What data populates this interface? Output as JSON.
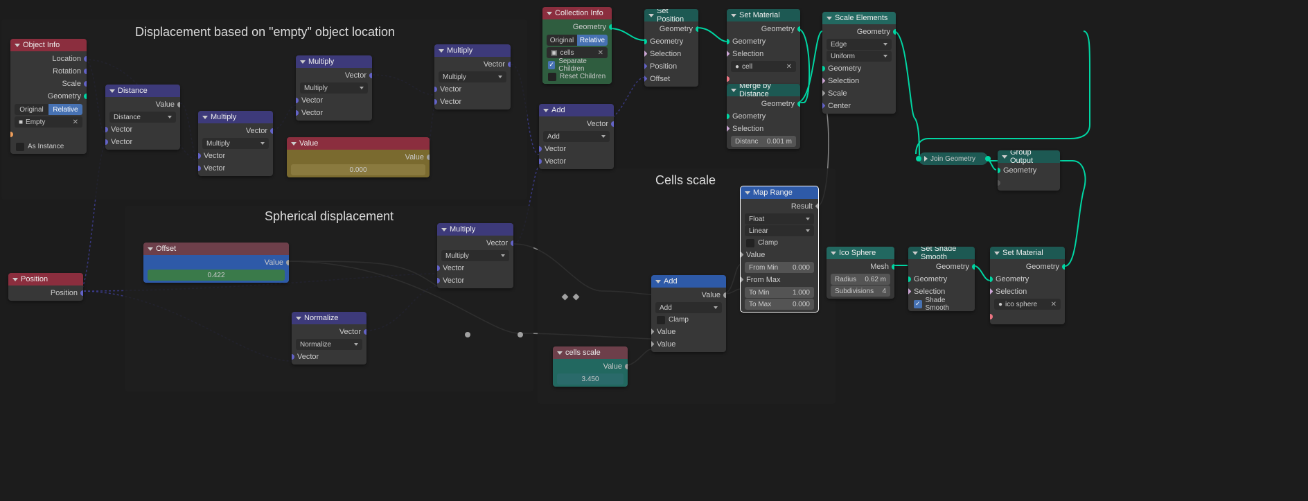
{
  "frames": {
    "f1": {
      "label": "Displacement based on \"empty\" object location"
    },
    "f2": {
      "label": "Spherical displacement"
    },
    "f3": {
      "label": "Cells scale"
    }
  },
  "nodes": {
    "object_info": {
      "title": "Object Info",
      "out": [
        "Location",
        "Rotation",
        "Scale",
        "Geometry"
      ],
      "toggle": [
        "Original",
        "Relative"
      ],
      "toggle_active": 1,
      "object": "Empty",
      "as_instance": "As Instance"
    },
    "distance": {
      "title": "Distance",
      "out": [
        "Value"
      ],
      "mode": "Distance",
      "in": [
        "Vector",
        "Vector"
      ]
    },
    "mult1": {
      "title": "Multiply",
      "out": [
        "Vector"
      ],
      "mode": "Multiply",
      "in": [
        "Vector",
        "Vector"
      ]
    },
    "mult2": {
      "title": "Multiply",
      "out": [
        "Vector"
      ],
      "mode": "Multiply",
      "in": [
        "Vector",
        "Vector"
      ]
    },
    "mult3": {
      "title": "Multiply",
      "out": [
        "Vector"
      ],
      "mode": "Multiply",
      "in": [
        "Vector",
        "Vector"
      ]
    },
    "value1": {
      "title": "Value",
      "value": "0.000"
    },
    "position": {
      "title": "Position",
      "out": [
        "Position"
      ]
    },
    "offset": {
      "title": "Offset",
      "out": [
        "Value"
      ],
      "value": "0.422"
    },
    "normalize": {
      "title": "Normalize",
      "out": [
        "Vector"
      ],
      "mode": "Normalize",
      "in": [
        "Vector"
      ]
    },
    "mult4": {
      "title": "Multiply",
      "out": [
        "Vector"
      ],
      "mode": "Multiply",
      "in": [
        "Vector",
        "Vector"
      ]
    },
    "add1": {
      "title": "Add",
      "out": [
        "Vector"
      ],
      "mode": "Add",
      "in": [
        "Vector",
        "Vector"
      ]
    },
    "collection_info": {
      "title": "Collection Info",
      "out": [
        "Geometry"
      ],
      "toggle": [
        "Original",
        "Relative"
      ],
      "toggle_active": 1,
      "collection": "cells",
      "separate": "Separate Children",
      "reset": "Reset Children"
    },
    "cells_scale": {
      "title": "cells scale",
      "out": [
        "Value"
      ],
      "value": "3.450"
    },
    "add2": {
      "title": "Add",
      "out": [
        "Value"
      ],
      "mode": "Add",
      "clamp": "Clamp",
      "in": [
        "Value",
        "Value"
      ]
    },
    "set_position": {
      "title": "Set Position",
      "out": [
        "Geometry"
      ],
      "in": [
        "Geometry",
        "Selection",
        "Position",
        "Offset"
      ]
    },
    "set_material1": {
      "title": "Set Material",
      "out": [
        "Geometry"
      ],
      "in": [
        "Geometry",
        "Selection"
      ],
      "mat": "cell"
    },
    "merge": {
      "title": "Merge by Distance",
      "out": [
        "Geometry"
      ],
      "in": [
        "Geometry",
        "Selection"
      ],
      "dist_label": "Distanc",
      "dist": "0.001 m"
    },
    "scale_elements": {
      "title": "Scale Elements",
      "out": [
        "Geometry"
      ],
      "mode1": "Edge",
      "mode2": "Uniform",
      "in": [
        "Geometry",
        "Selection",
        "Scale",
        "Center"
      ]
    },
    "map_range": {
      "title": "Map Range",
      "out": [
        "Result"
      ],
      "type": "Float",
      "interp": "Linear",
      "clamp": "Clamp",
      "value_label": "Value",
      "from_min_l": "From Min",
      "from_min": "0.000",
      "from_max_l": "From Max",
      "to_min_l": "To Min",
      "to_min": "1.000",
      "to_max_l": "To Max",
      "to_max": "0.000"
    },
    "ico_sphere": {
      "title": "Ico Sphere",
      "out": [
        "Mesh"
      ],
      "radius_l": "Radius",
      "radius": "0.62 m",
      "subdiv_l": "Subdivisions",
      "subdiv": "4"
    },
    "set_shade": {
      "title": "Set Shade Smooth",
      "out": [
        "Geometry"
      ],
      "in": [
        "Geometry",
        "Selection"
      ],
      "shade": "Shade Smooth"
    },
    "set_material2": {
      "title": "Set Material",
      "out": [
        "Geometry"
      ],
      "in": [
        "Geometry",
        "Selection"
      ],
      "mat": "ico sphere"
    },
    "join_geometry": {
      "title": "Join Geometry"
    },
    "group_output": {
      "title": "Group Output",
      "in": [
        "Geometry"
      ]
    }
  }
}
